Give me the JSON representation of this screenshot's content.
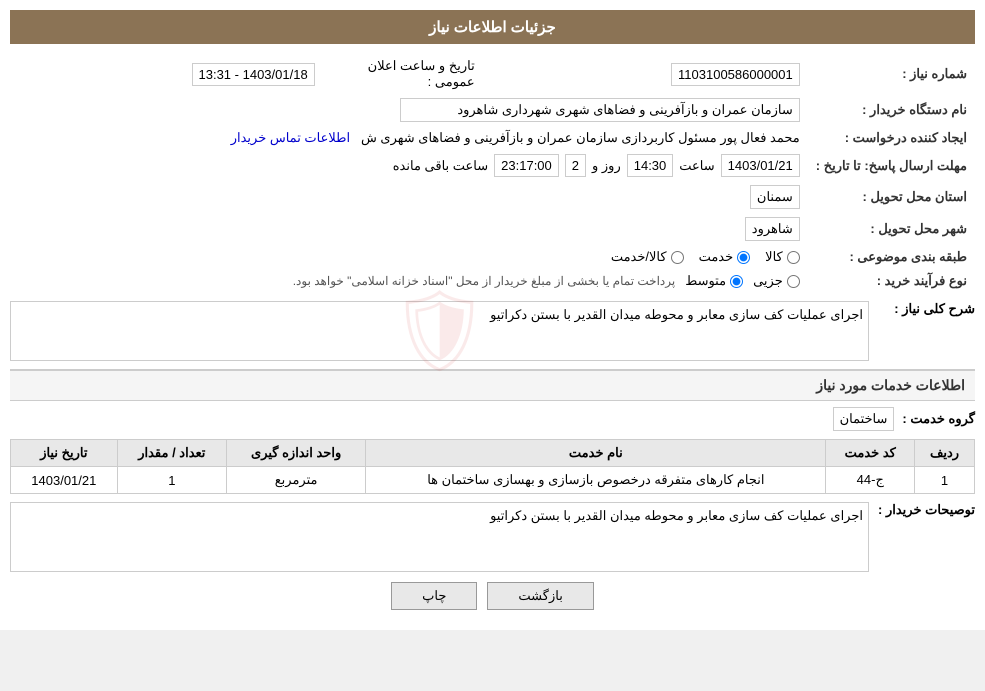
{
  "header": {
    "title": "جزئیات اطلاعات نیاز"
  },
  "fields": {
    "shenare_niaz_label": "شماره نیاز :",
    "shenare_niaz_value": "1103100586000001",
    "tarikhe_elan_label": "تاریخ و ساعت اعلان عمومی :",
    "tarikhe_elan_value": "1403/01/18 - 13:31",
    "name_dastgah_label": "نام دستگاه خریدار :",
    "name_dastgah_value": "سازمان عمران و بازآفرینی و فضاهای شهری شهرداری شاهرود",
    "ijad_konande_label": "ایجاد کننده درخواست :",
    "ijad_konande_value": "محمد فعال پور مسئول کاربردازی سازمان عمران و بازآفرینی و فضاهای شهری ش",
    "ettelaat_tamas_label": "اطلاعات تماس خریدار",
    "mohlat_ersal_label": "مهلت ارسال پاسخ: تا تاریخ :",
    "mohlat_date": "1403/01/21",
    "mohlat_saat_label": "ساعت",
    "mohlat_saat_value": "14:30",
    "mohlat_rooz_label": "روز و",
    "mohlat_rooz_value": "2",
    "mohlat_remaining_label": "ساعت باقی مانده",
    "mohlat_remaining_value": "23:17:00",
    "ostan_label": "استان محل تحویل :",
    "ostan_value": "سمنان",
    "shahr_label": "شهر محل تحویل :",
    "shahr_value": "شاهرود",
    "tabaqe_label": "طبقه بندی موضوعی :",
    "tabaqe_options": [
      {
        "label": "کالا",
        "selected": false
      },
      {
        "label": "خدمت",
        "selected": true
      },
      {
        "label": "کالا/خدمت",
        "selected": false
      }
    ],
    "farande_label": "نوع فرآیند خرید :",
    "farande_options": [
      {
        "label": "جزیی",
        "selected": false
      },
      {
        "label": "متوسط",
        "selected": true
      },
      {
        "label": "",
        "selected": false
      }
    ],
    "farande_note": "پرداخت تمام یا بخشی از مبلغ خریدار از محل \"اسناد خزانه اسلامی\" خواهد بود.",
    "sharh_label": "شرح کلی نیاز :",
    "sharh_value": "اجرای عملیات کف سازی معابر و محوطه میدان القدیر با بستن دکراتیو",
    "service_info_title": "اطلاعات خدمات مورد نیاز",
    "grooh_khedmat_label": "گروه خدمت :",
    "grooh_khedmat_value": "ساختمان",
    "table_headers": [
      "ردیف",
      "کد خدمت",
      "نام خدمت",
      "واحد اندازه گیری",
      "تعداد / مقدار",
      "تاریخ نیاز"
    ],
    "table_rows": [
      {
        "row": "1",
        "code": "ج-44",
        "name": "انجام کارهای متفرقه درخصوص بازسازی و بهسازی ساختمان ها",
        "unit": "مترمربع",
        "quantity": "1",
        "date": "1403/01/21"
      }
    ],
    "tosif_label": "توصیحات خریدار :",
    "tosif_value": "اجرای عملیات کف سازی معابر و محوطه میدان القدیر با بستن دکراتیو"
  },
  "buttons": {
    "print_label": "چاپ",
    "back_label": "بازگشت"
  }
}
